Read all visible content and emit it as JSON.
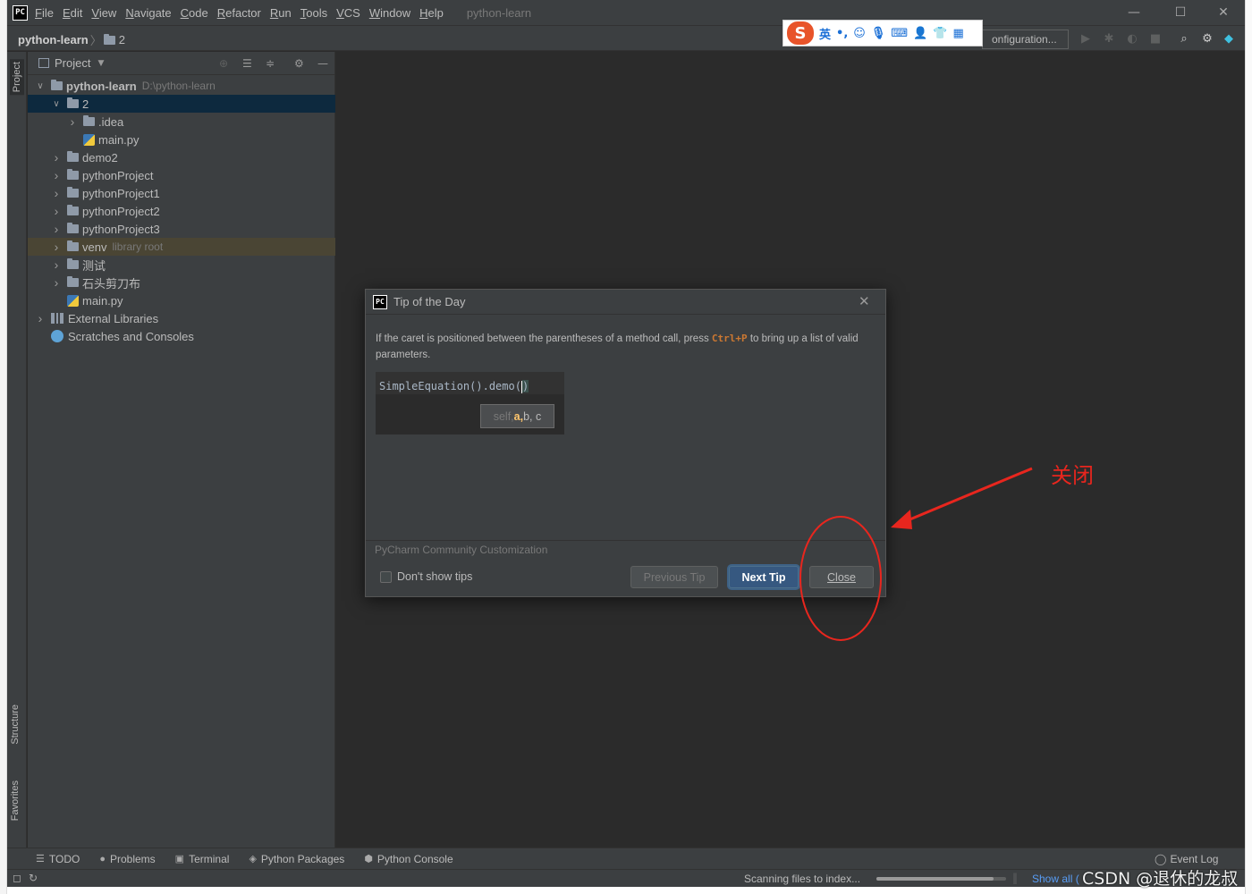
{
  "app": {
    "title": "python-learn",
    "logo": "PC"
  },
  "menu": [
    "File",
    "Edit",
    "View",
    "Navigate",
    "Code",
    "Refactor",
    "Run",
    "Tools",
    "VCS",
    "Window",
    "Help"
  ],
  "breadcrumb": {
    "root": "python-learn",
    "sep": "〉",
    "child": "2"
  },
  "ime_toolbar": {
    "logo": "S",
    "lang": "英",
    "punct": "•,"
  },
  "run_config": {
    "label": "onfiguration..."
  },
  "tool_stripe": {
    "project": "Project",
    "structure": "Structure",
    "favorites": "Favorites"
  },
  "project_panel": {
    "title": "Project",
    "tree": [
      {
        "label": "python-learn",
        "suffix": "D:\\python-learn",
        "kind": "folder",
        "expanded": true
      },
      {
        "label": "2",
        "kind": "folder",
        "expanded": true,
        "selected": true
      },
      {
        "label": ".idea",
        "kind": "folder",
        "expanded": false
      },
      {
        "label": "main.py",
        "kind": "python"
      },
      {
        "label": "demo2",
        "kind": "folder",
        "expanded": false
      },
      {
        "label": "pythonProject",
        "kind": "folder",
        "expanded": false
      },
      {
        "label": "pythonProject1",
        "kind": "folder",
        "expanded": false
      },
      {
        "label": "pythonProject2",
        "kind": "folder",
        "expanded": false
      },
      {
        "label": "pythonProject3",
        "kind": "folder",
        "expanded": false
      },
      {
        "label": "venv",
        "suffix": "library root",
        "kind": "folder",
        "expanded": false
      },
      {
        "label": "测试",
        "kind": "folder",
        "expanded": false
      },
      {
        "label": "石头剪刀布",
        "kind": "folder",
        "expanded": false
      },
      {
        "label": "main.py",
        "kind": "python"
      },
      {
        "label": "External Libraries",
        "kind": "library",
        "expanded": false
      },
      {
        "label": "Scratches and Consoles",
        "kind": "scratch"
      }
    ]
  },
  "dialog": {
    "title": "Tip of the Day",
    "text_before": "If the caret is positioned between the parentheses of a method call, press ",
    "shortcut": "Ctrl+P",
    "text_after": " to bring up a list of valid parameters.",
    "code": "SimpleEquation().demo(",
    "code_close": ")",
    "param_hint": {
      "first": "self, ",
      "current": "a,",
      "rest": " b, c"
    },
    "footer_label": "PyCharm Community Customization",
    "checkbox_label": "Don't show tips",
    "checkbox_checked": false,
    "prev_button": "Previous Tip",
    "next_button": "Next Tip",
    "close_button": "Close"
  },
  "bottom_tabs": [
    "TODO",
    "Problems",
    "Terminal",
    "Python Packages",
    "Python Console"
  ],
  "event_log": "Event Log",
  "status": {
    "scanning": "Scanning files to index...",
    "show_all": "Show all (",
    "progress": 0.9
  },
  "annotation": {
    "text": "关闭",
    "color": "#e8261e"
  },
  "watermark": "CSDN @退休的龙叔",
  "colors": {
    "bg": "#2b2b2b",
    "panel": "#3c3f41",
    "selection": "#0d293e",
    "library_row": "#4a4534",
    "accent_button": "#365880"
  }
}
